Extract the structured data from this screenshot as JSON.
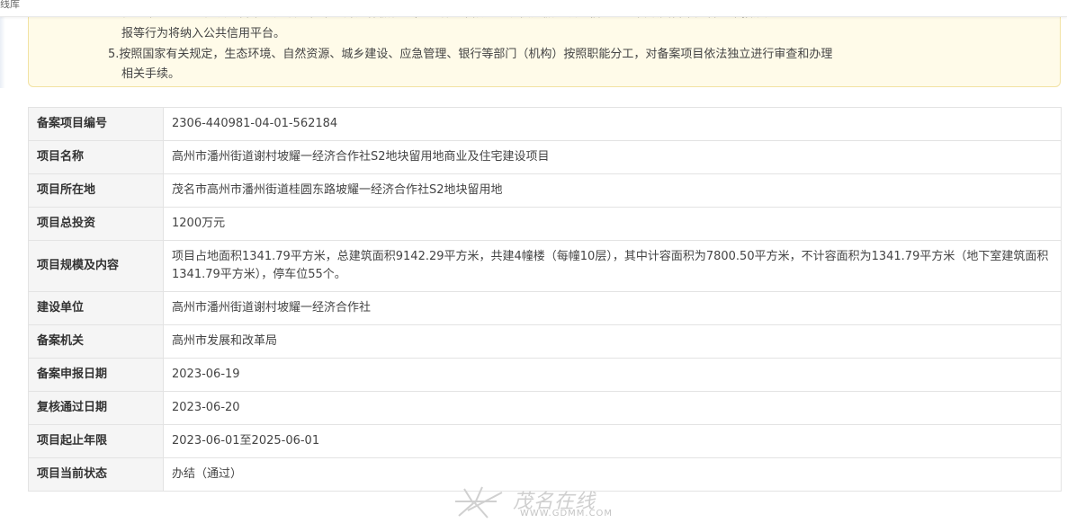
{
  "header": {
    "crumb": "线库"
  },
  "notice": {
    "line1": "任何单位、个人在项目备案、建设过程中的弄虚作假行为，包括但不限于：提供虚假的项目信息、擅自改变备案内容、不按规定",
    "line2": "报等行为将纳入公共信用平台。",
    "line3": "5.按照国家有关规定，生态环境、自然资源、城乡建设、应急管理、银行等部门（机构）按照职能分工，对备案项目依法独立进行审查和办理",
    "line4": "相关手续。"
  },
  "project": {
    "rows": [
      {
        "key": "备案项目编号",
        "value": "2306-440981-04-01-562184"
      },
      {
        "key": "项目名称",
        "value": "高州市潘州街道谢村坡耀一经济合作社S2地块留用地商业及住宅建设项目"
      },
      {
        "key": "项目所在地",
        "value": "茂名市高州市潘州街道桂圆东路坡耀一经济合作社S2地块留用地"
      },
      {
        "key": "项目总投资",
        "value": "1200万元"
      },
      {
        "key": "项目规模及内容",
        "value": "项目占地面积1341.79平方米，总建筑面积9142.29平方米，共建4幢楼（每幢10层），其中计容面积为7800.50平方米，不计容面积为1341.79平方米（地下室建筑面积1341.79平方米），停车位55个。"
      },
      {
        "key": "建设单位",
        "value": "高州市潘州街道谢村坡耀一经济合作社"
      },
      {
        "key": "备案机关",
        "value": "高州市发展和改革局"
      },
      {
        "key": "备案申报日期",
        "value": "2023-06-19"
      },
      {
        "key": "复核通过日期",
        "value": "2023-06-20"
      },
      {
        "key": "项目起止年限",
        "value": "2023-06-01至2025-06-01"
      },
      {
        "key": "项目当前状态",
        "value": "办结（通过）"
      }
    ]
  },
  "watermark": {
    "name": "茂名在线",
    "url": "WWW.GDMM.COM",
    "icon": "star-logo-icon"
  }
}
